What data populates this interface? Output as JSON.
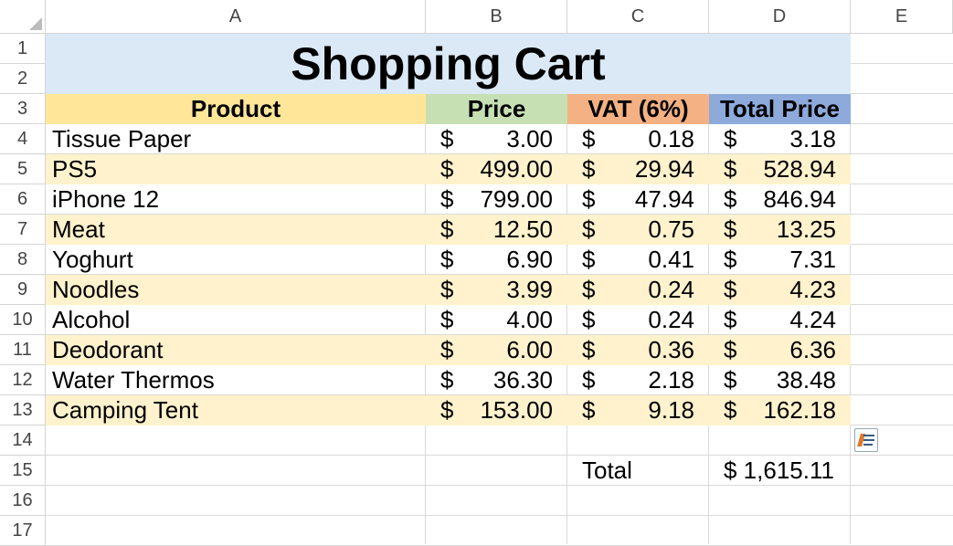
{
  "columns": [
    "A",
    "B",
    "C",
    "D",
    "E"
  ],
  "rows": [
    "1",
    "2",
    "3",
    "4",
    "5",
    "6",
    "7",
    "8",
    "9",
    "10",
    "11",
    "12",
    "13",
    "14",
    "15",
    "16",
    "17"
  ],
  "title": "Shopping Cart",
  "headers": {
    "product": "Product",
    "price": "Price",
    "vat": "VAT (6%)",
    "total_price": "Total Price"
  },
  "currency_symbol": "$",
  "items": [
    {
      "product": "Tissue Paper",
      "price": "3.00",
      "vat": "0.18",
      "total": "3.18"
    },
    {
      "product": "PS5",
      "price": "499.00",
      "vat": "29.94",
      "total": "528.94"
    },
    {
      "product": "iPhone 12",
      "price": "799.00",
      "vat": "47.94",
      "total": "846.94"
    },
    {
      "product": "Meat",
      "price": "12.50",
      "vat": "0.75",
      "total": "13.25"
    },
    {
      "product": "Yoghurt",
      "price": "6.90",
      "vat": "0.41",
      "total": "7.31"
    },
    {
      "product": "Noodles",
      "price": "3.99",
      "vat": "0.24",
      "total": "4.23"
    },
    {
      "product": "Alcohol",
      "price": "4.00",
      "vat": "0.24",
      "total": "4.24"
    },
    {
      "product": "Deodorant",
      "price": "6.00",
      "vat": "0.36",
      "total": "6.36"
    },
    {
      "product": "Water Thermos",
      "price": "36.30",
      "vat": "2.18",
      "total": "38.48"
    },
    {
      "product": "Camping Tent",
      "price": "153.00",
      "vat": "9.18",
      "total": "162.18"
    }
  ],
  "summary": {
    "label": "Total",
    "value": "$ 1,615.11"
  },
  "colors": {
    "title_bg": "#dbe9f7",
    "product_header": "#ffe699",
    "price_header": "#c6e0b4",
    "vat_header": "#f4b183",
    "total_header": "#8eaadb",
    "band": "#fff2cc"
  },
  "icons": {
    "quick_analysis": "quick-analysis-icon"
  }
}
